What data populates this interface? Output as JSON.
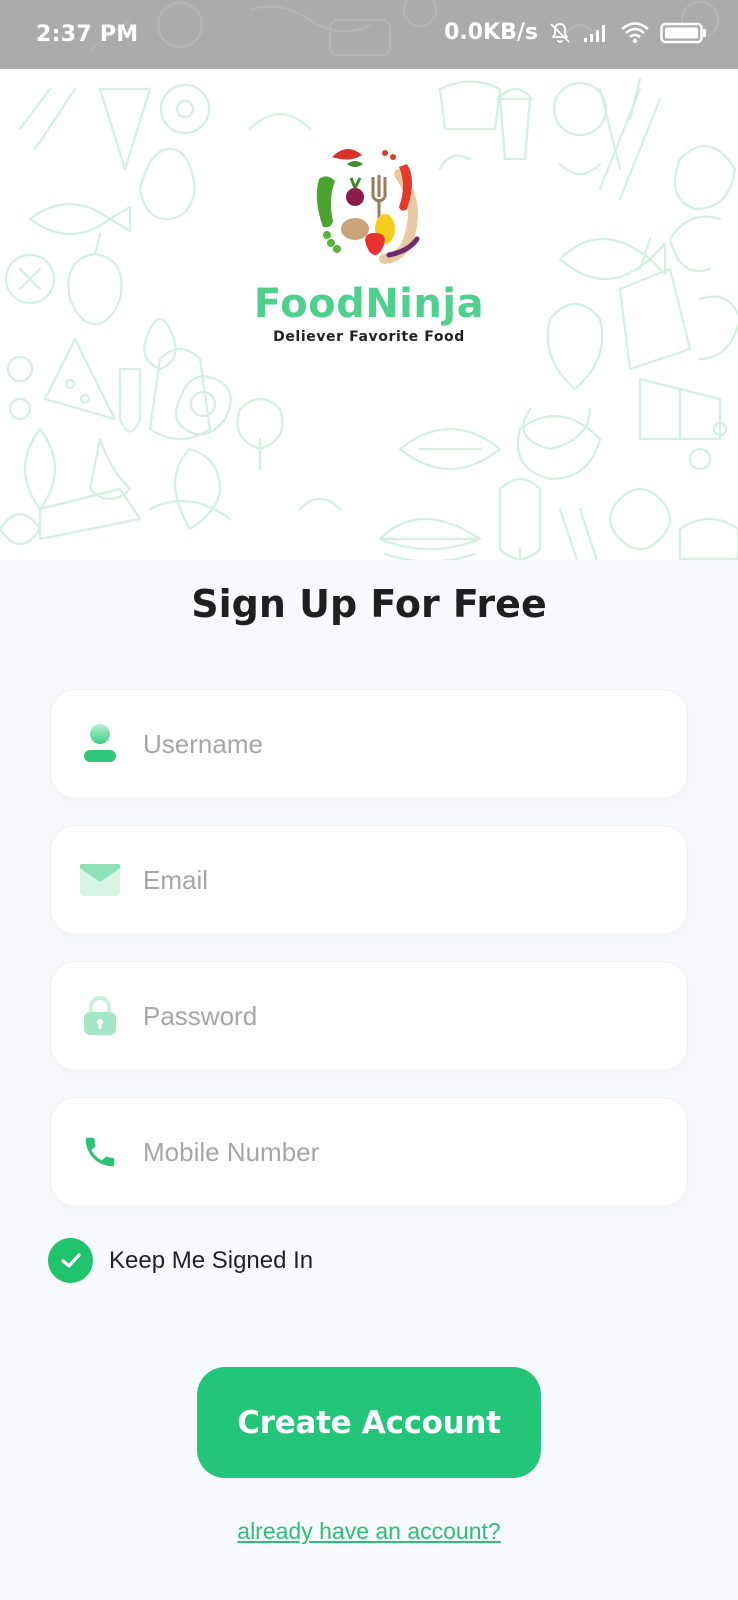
{
  "status_bar": {
    "time": "2:37 PM",
    "net_speed": "0.0KB/s",
    "icons": [
      "bell-off-icon",
      "signal-icon",
      "wifi-icon",
      "battery-icon"
    ]
  },
  "brand": {
    "name": "FoodNinja",
    "tagline": "Deliever Favorite Food",
    "accent_color": "#4fd08c"
  },
  "form": {
    "title": "Sign Up For Free",
    "fields": [
      {
        "icon": "user-icon",
        "placeholder": "Username",
        "value": ""
      },
      {
        "icon": "mail-icon",
        "placeholder": "Email",
        "value": ""
      },
      {
        "icon": "lock-icon",
        "placeholder": "Password",
        "value": ""
      },
      {
        "icon": "phone-icon",
        "placeholder": "Mobile Number",
        "value": ""
      }
    ],
    "keep_signed_in": {
      "label": "Keep Me Signed In",
      "checked": true
    },
    "submit_label": "Create Account",
    "signin_link": "already have an account?",
    "primary_color": "#23c679"
  }
}
